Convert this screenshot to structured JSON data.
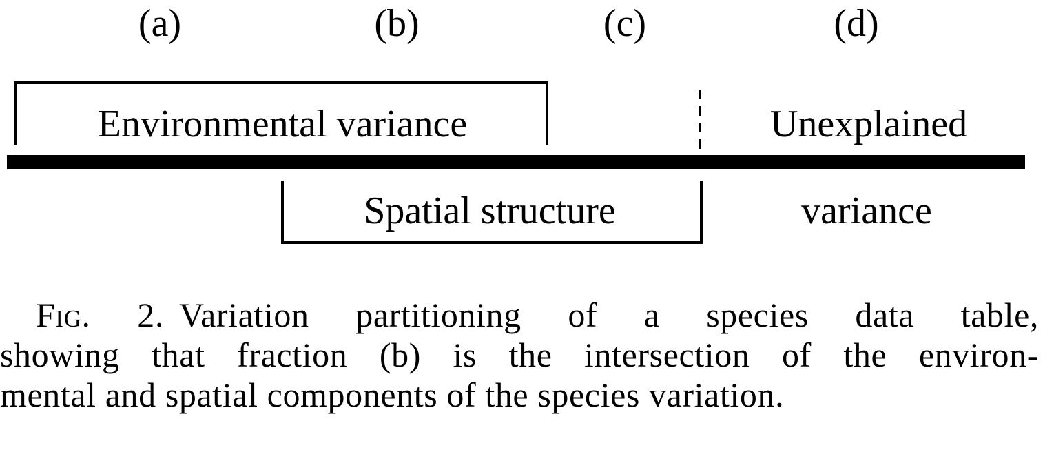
{
  "fractions": {
    "a": "(a)",
    "b": "(b)",
    "c": "(c)",
    "d": "(d)"
  },
  "boxes": {
    "environmental": "Environmental variance",
    "spatial": "Spatial structure",
    "unexplained_line1": "Unexplained",
    "unexplained_line2": "variance"
  },
  "caption": {
    "fig_number": "Fig. 2.",
    "line1": "Variation partitioning of a species data table,",
    "line2": "showing that fraction (b) is the intersection of the environ-",
    "line3": "mental and spatial components of the species variation."
  }
}
